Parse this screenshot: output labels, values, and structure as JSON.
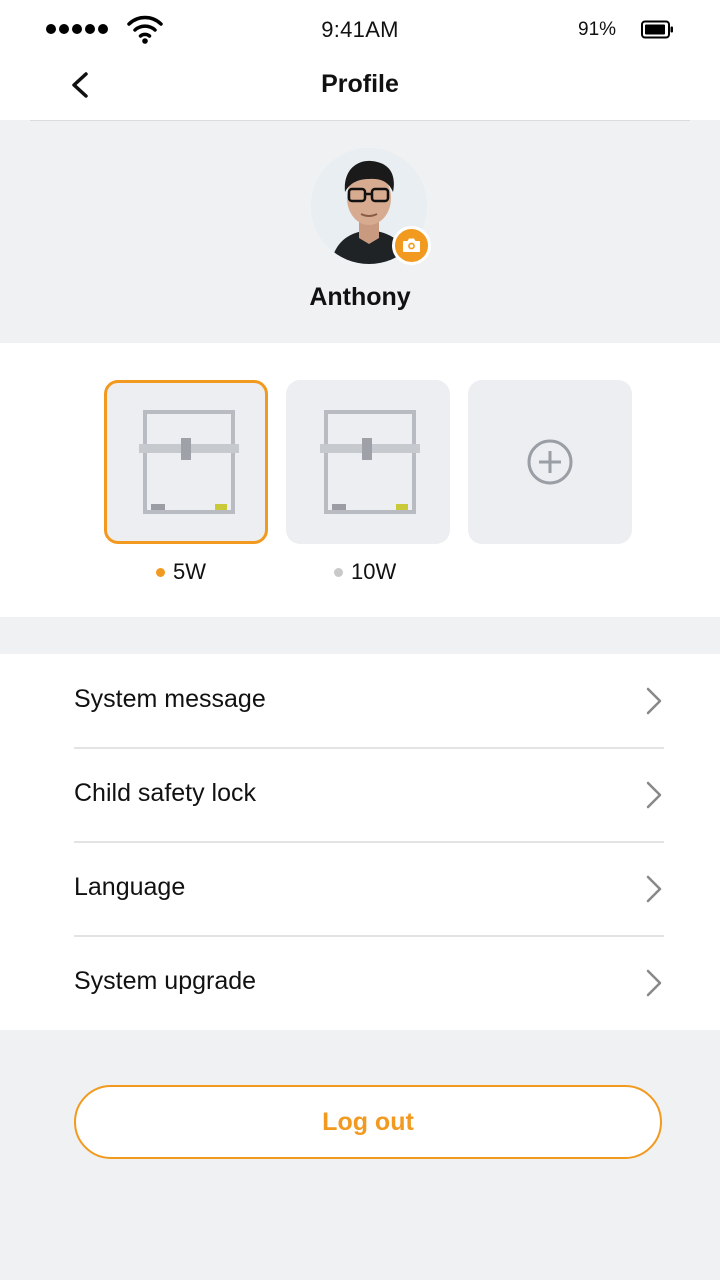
{
  "status_bar": {
    "time": "9:41AM",
    "battery": "91%"
  },
  "header": {
    "title": "Profile"
  },
  "profile": {
    "name": "Anthony"
  },
  "devices": [
    {
      "label": "5W",
      "status_color": "#f29a1f",
      "selected": true,
      "icon": "laser-engraver-frame"
    },
    {
      "label": "10W",
      "status_color": "#c9c9c9",
      "selected": false,
      "icon": "laser-engraver-frame"
    }
  ],
  "add_device_icon": "plus-circle-icon",
  "menu": [
    {
      "label": "System message"
    },
    {
      "label": "Child safety lock"
    },
    {
      "label": "Language"
    },
    {
      "label": "System upgrade"
    }
  ],
  "logout": {
    "label": "Log out"
  },
  "colors": {
    "accent": "#f29a1f",
    "background": "#f0f1f3",
    "card": "#eceef2"
  }
}
